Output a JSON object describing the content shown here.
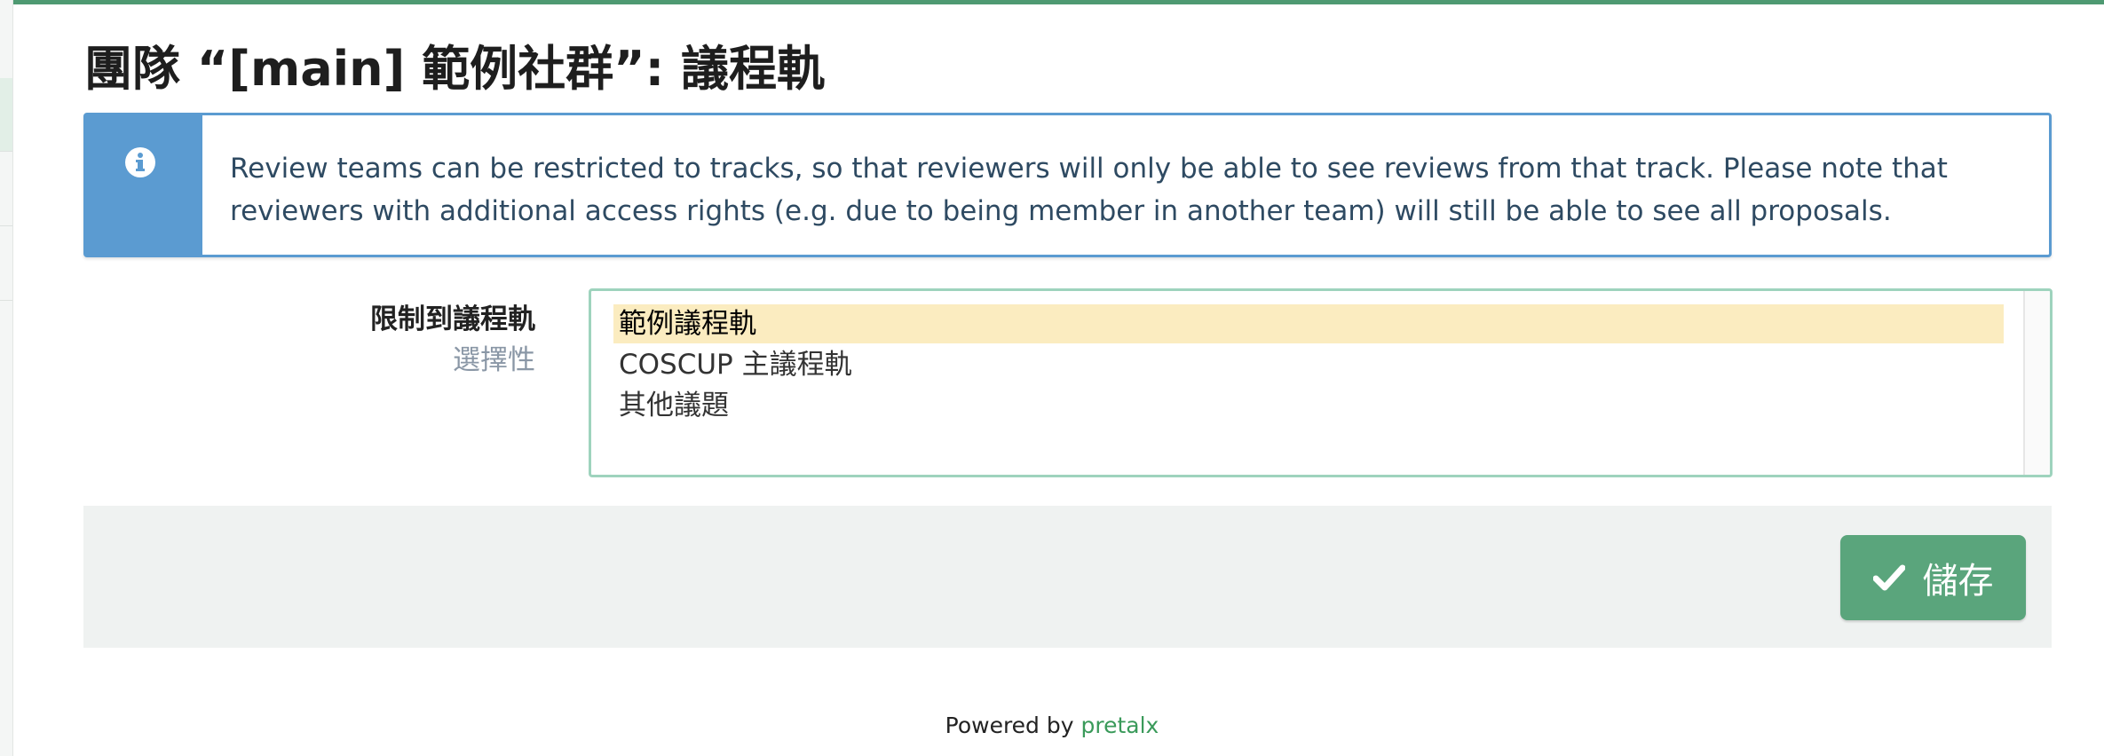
{
  "page": {
    "title": "團隊 “[main] 範例社群”: 議程軌"
  },
  "info": {
    "icon": "info-circle-icon",
    "text": "Review teams can be restricted to tracks, so that reviewers will only be able to see reviews from that track. Please note that reviewers with additional access rights (e.g. due to being member in another team) will still be able to see all proposals."
  },
  "field": {
    "label": "限制到議程軌",
    "hint": "選擇性",
    "options": [
      {
        "label": "範例議程軌",
        "selected": true
      },
      {
        "label": "COSCUP 主議程軌",
        "selected": false
      },
      {
        "label": "其他議題",
        "selected": false
      }
    ]
  },
  "actions": {
    "save_label": "儲存",
    "save_icon": "check-icon"
  },
  "footer": {
    "powered_by": "Powered by",
    "brand": "pretalx"
  },
  "colors": {
    "accent": "#5aa57c",
    "info": "#5b9bd1",
    "selected_option": "#fbecc0"
  }
}
